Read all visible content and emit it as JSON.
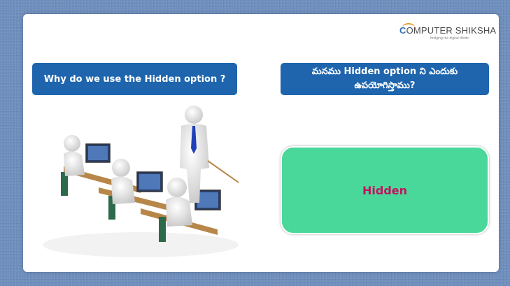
{
  "logo": {
    "first_letter": "C",
    "brand_rest": "OMPUTER SHIKSHA",
    "tagline": "bridging the digital divide"
  },
  "question_en": "Why do we use the Hidden option ?",
  "question_te": "మనము Hidden option ని ఎందుకు ఉపయోగిస్తాము?",
  "answer": "Hidden",
  "illustration": {
    "icon": "classroom-computers-illustration"
  },
  "colors": {
    "banner": "#1e65ae",
    "answer_box": "#49d89a",
    "answer_text": "#c4125f",
    "background": "#6f8fbd"
  }
}
